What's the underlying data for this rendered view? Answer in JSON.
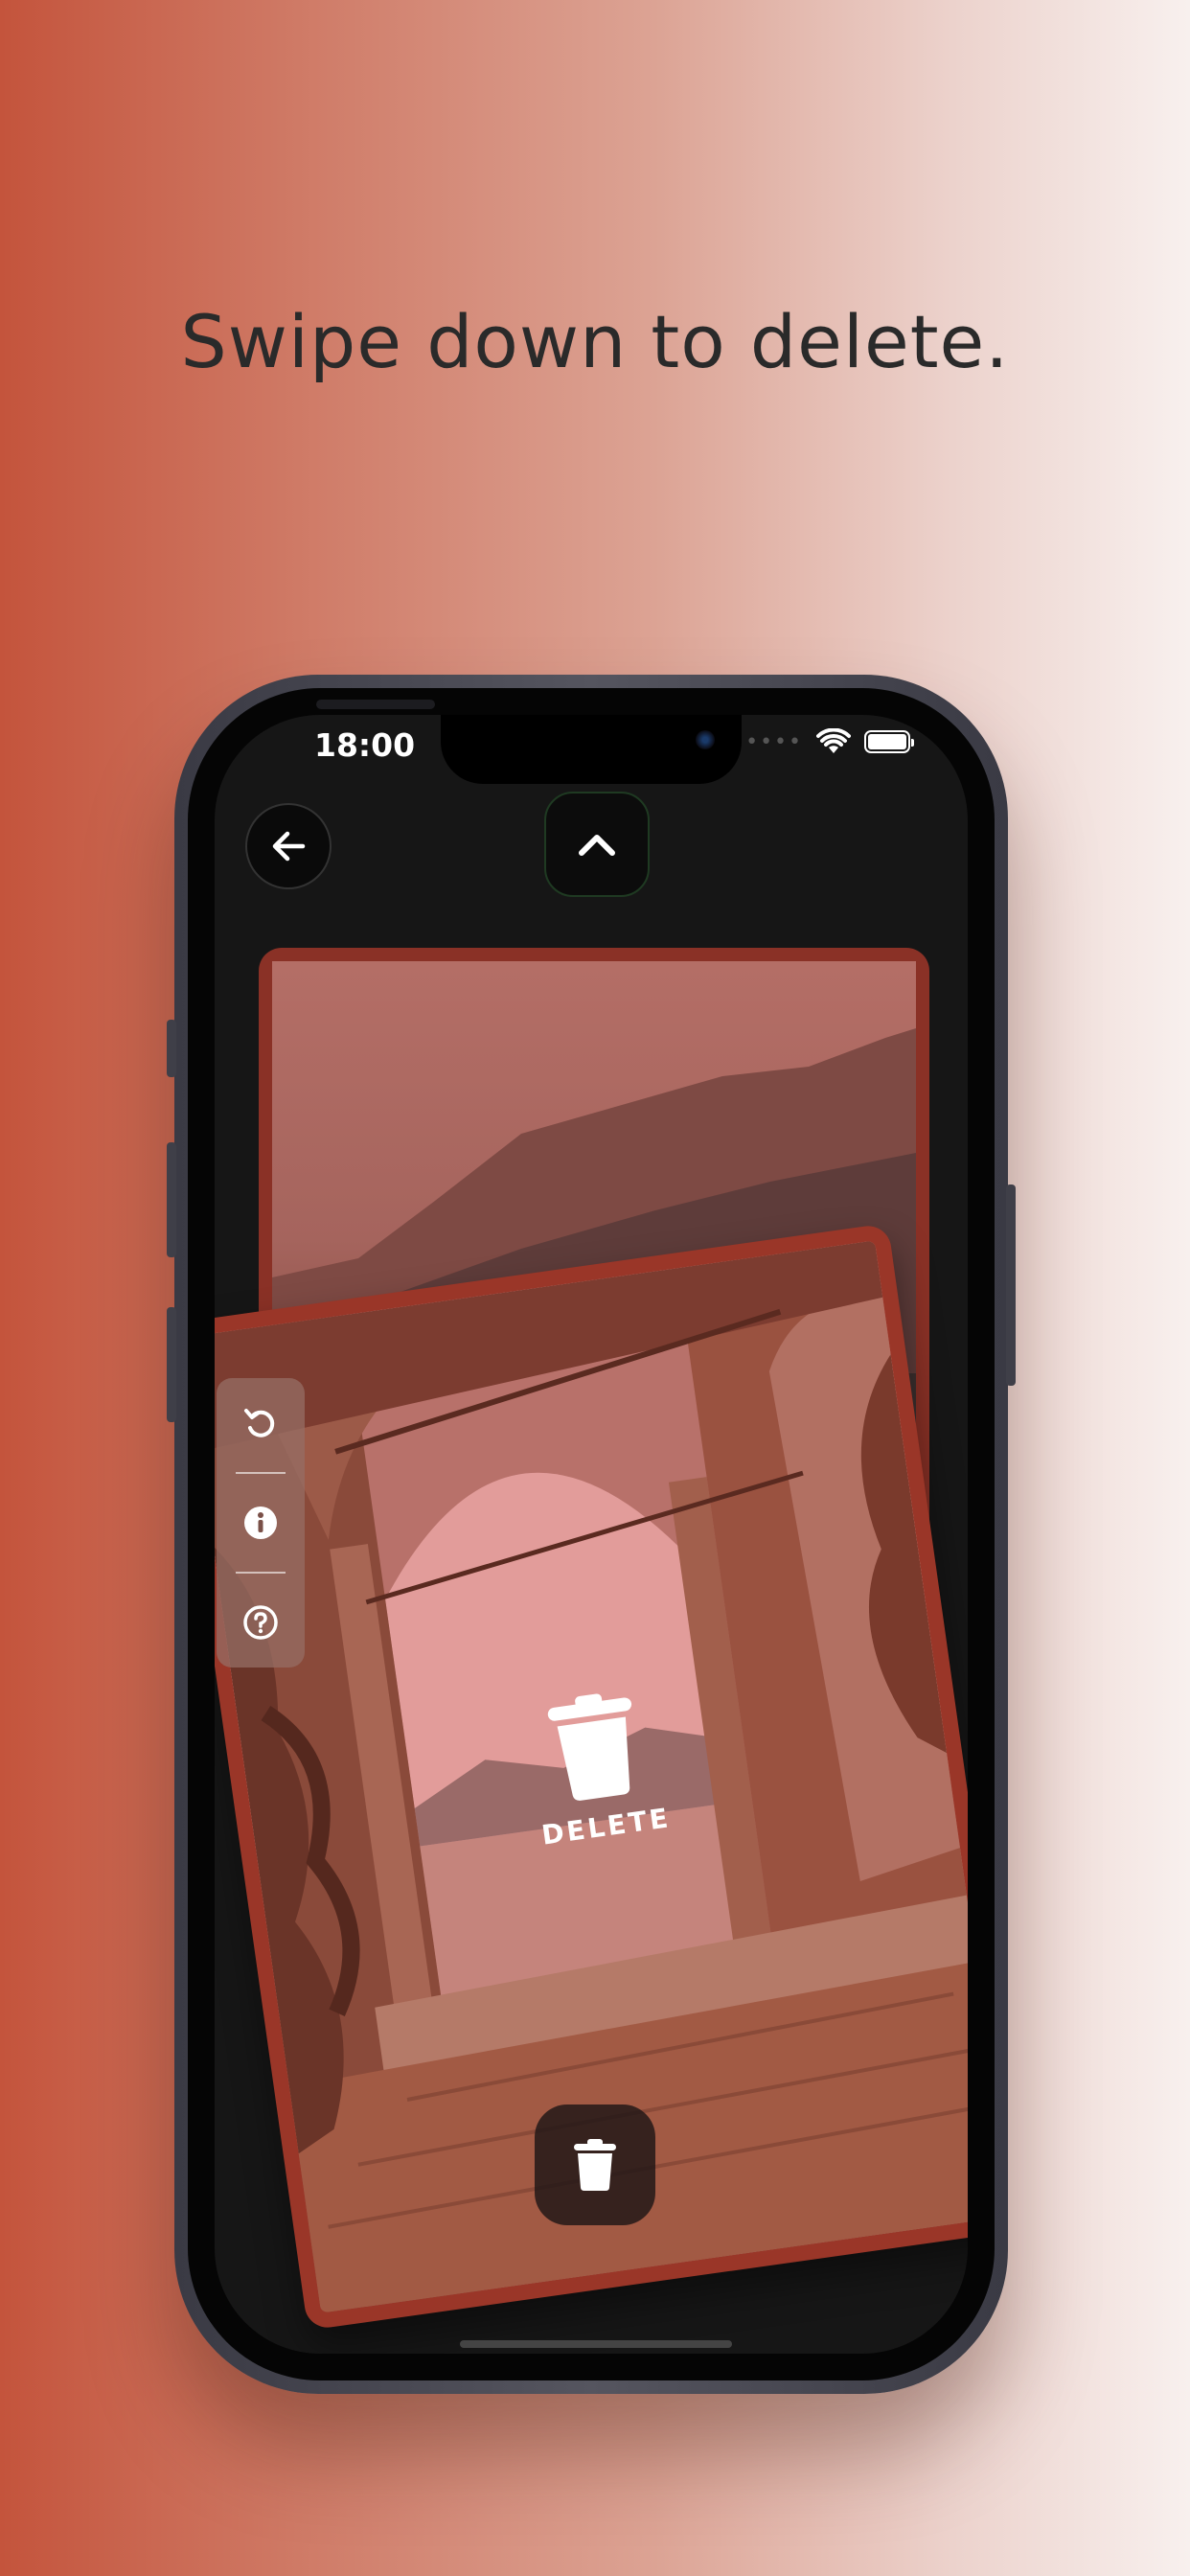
{
  "headline": "Swipe down to delete.",
  "status_bar": {
    "time": "18:00"
  },
  "nav": {
    "back_icon": "arrow-left-icon",
    "up_icon": "chevron-up-icon"
  },
  "side_panel": {
    "items": [
      {
        "icon": "undo-icon"
      },
      {
        "icon": "info-icon"
      },
      {
        "icon": "help-icon"
      }
    ]
  },
  "delete_overlay": {
    "label": "DELETE",
    "icon": "trash-icon"
  },
  "bottom_action": {
    "icon": "trash-icon"
  },
  "colors": {
    "accent": "#c4543c",
    "card_border": "#9a3628",
    "screen_bg": "#161616"
  }
}
